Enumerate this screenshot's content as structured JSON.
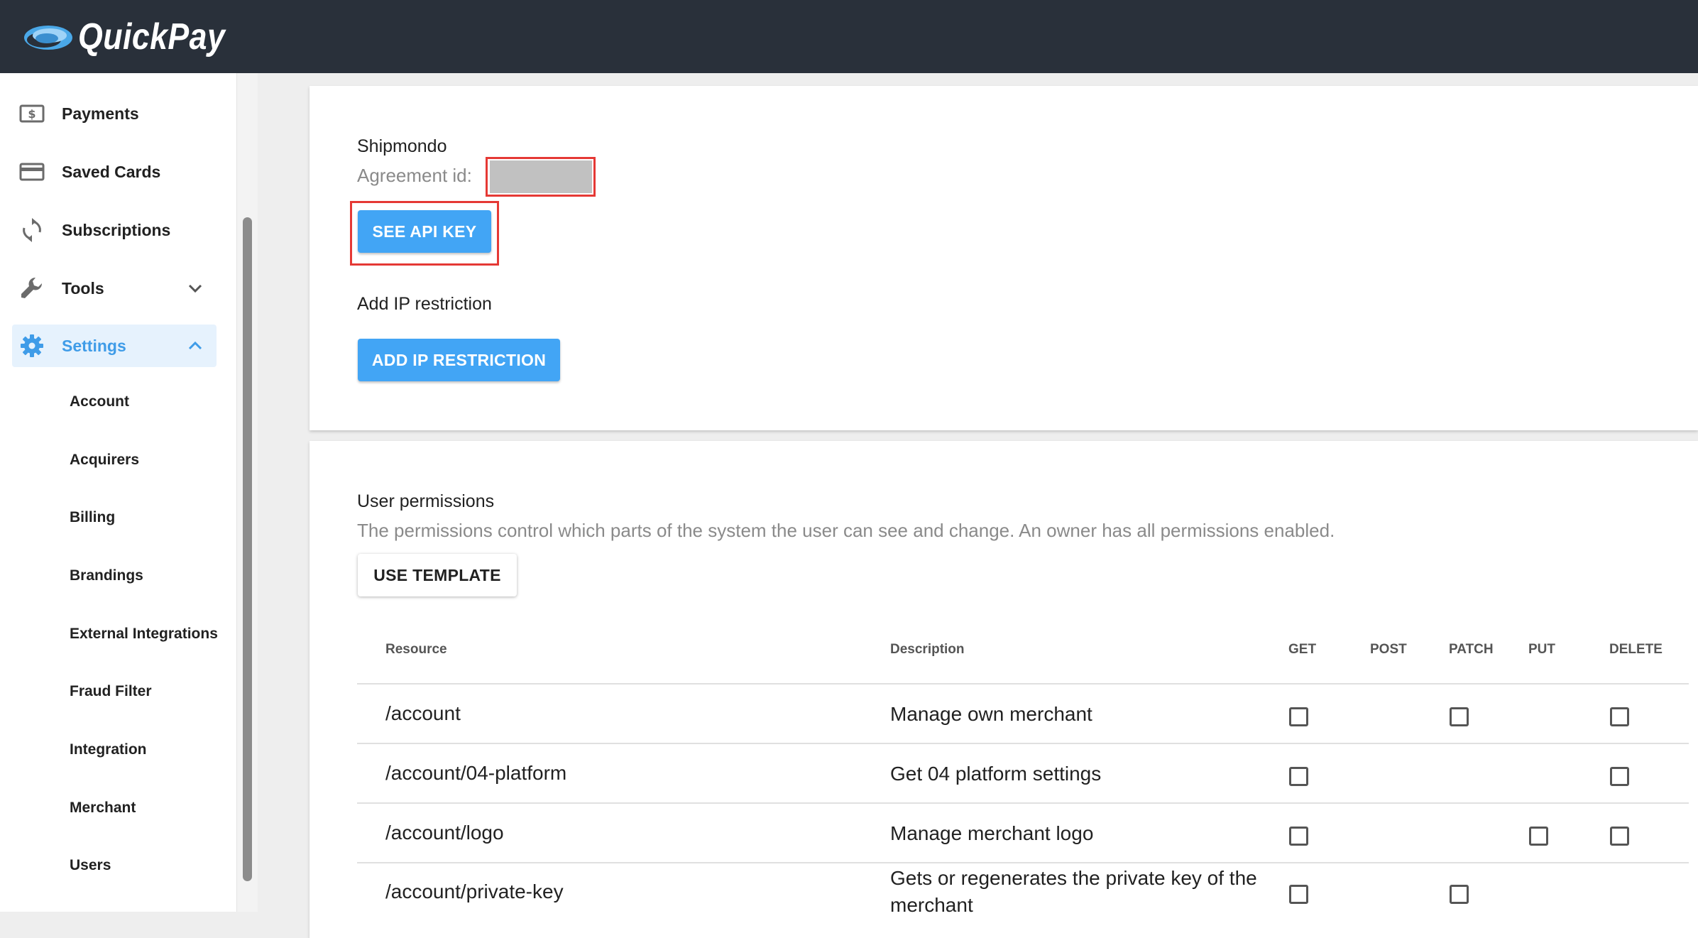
{
  "app": {
    "name": "QuickPay"
  },
  "sidebar": {
    "items": [
      {
        "label": "Payments",
        "icon": "payments-icon"
      },
      {
        "label": "Saved Cards",
        "icon": "credit-card-icon"
      },
      {
        "label": "Subscriptions",
        "icon": "sync-icon"
      },
      {
        "label": "Tools",
        "icon": "wrench-icon",
        "expanded": false
      },
      {
        "label": "Settings",
        "icon": "gear-icon",
        "expanded": true,
        "active": true
      }
    ],
    "settings_children": [
      "Account",
      "Acquirers",
      "Billing",
      "Brandings",
      "External Integrations",
      "Fraud Filter",
      "Integration",
      "Merchant",
      "Users"
    ]
  },
  "agreement": {
    "name": "Shipmondo",
    "id_label": "Agreement id:",
    "see_api_key_label": "SEE API KEY",
    "ip_restriction_title": "Add IP restriction",
    "add_ip_label": "ADD IP RESTRICTION"
  },
  "permissions": {
    "title": "User permissions",
    "description": "The permissions control which parts of the system the user can see and change. An owner has all permissions enabled.",
    "use_template_label": "USE TEMPLATE",
    "columns": [
      "Resource",
      "Description",
      "GET",
      "POST",
      "PATCH",
      "PUT",
      "DELETE"
    ],
    "rows": [
      {
        "resource": "/account",
        "description": "Manage own merchant",
        "methods": [
          "GET",
          "PATCH",
          "DELETE"
        ]
      },
      {
        "resource": "/account/04-platform",
        "description": "Get 04 platform settings",
        "methods": [
          "GET",
          "DELETE"
        ]
      },
      {
        "resource": "/account/logo",
        "description": "Manage merchant logo",
        "methods": [
          "GET",
          "PUT",
          "DELETE"
        ]
      },
      {
        "resource": "/account/private-key",
        "description": "Gets or regenerates the private key of the merchant",
        "methods": [
          "GET",
          "PATCH"
        ]
      }
    ]
  },
  "colors": {
    "header_bg": "#29303a",
    "accent": "#42a5f5",
    "active_bg": "#e6f2fd",
    "highlight_red": "#e53935"
  }
}
